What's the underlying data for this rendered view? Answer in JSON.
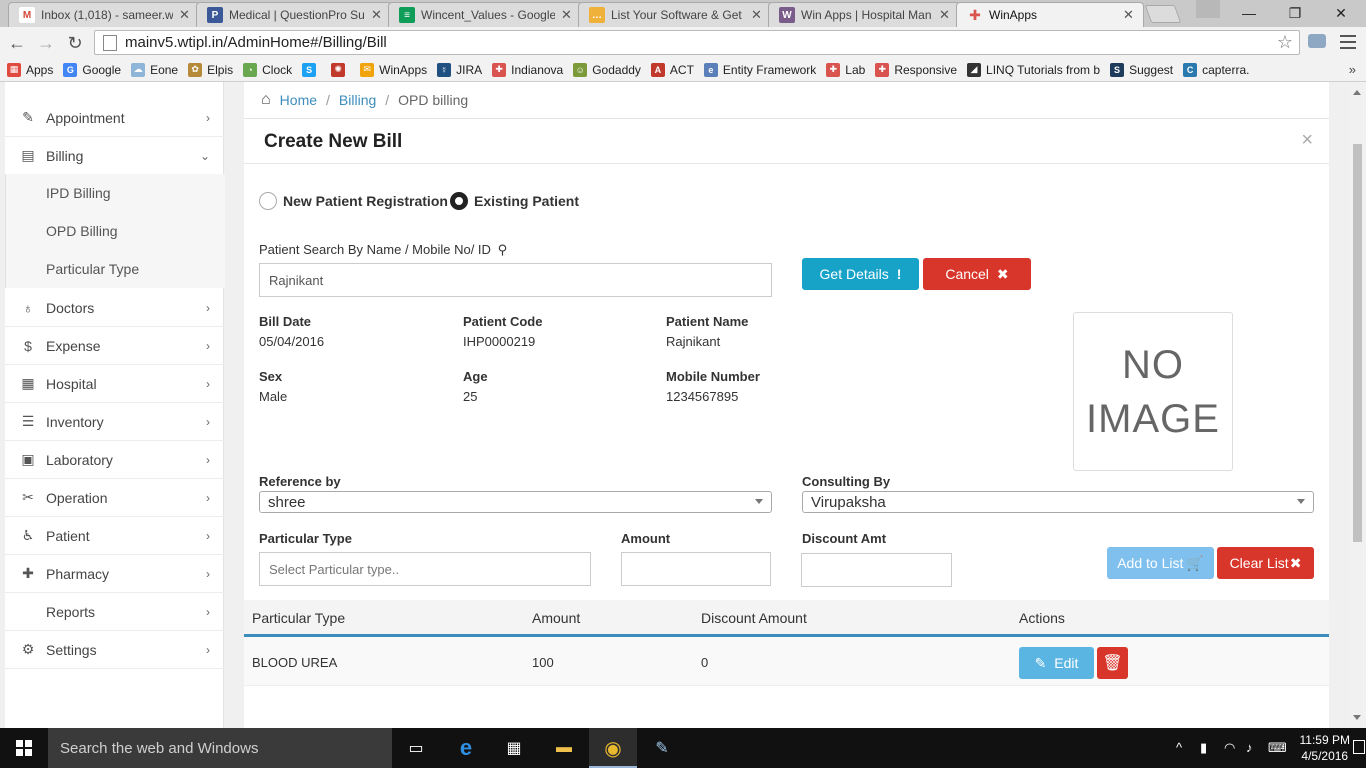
{
  "browser": {
    "tabs": [
      {
        "title": "Inbox (1,018) - sameer.wi",
        "icon": "gmail-icon",
        "color": "#d44638",
        "glyph": "M"
      },
      {
        "title": "Medical | QuestionPro Su",
        "icon": "questionpro-icon",
        "color": "#3b5998",
        "glyph": "P"
      },
      {
        "title": "Wincent_Values - Google",
        "icon": "google-sheets-icon",
        "color": "#0f9d58",
        "glyph": "≡"
      },
      {
        "title": "List Your Software & Get",
        "icon": "chat-bubble-icon",
        "color": "#f0b13a",
        "glyph": "…"
      },
      {
        "title": "Win Apps | Hospital Man",
        "icon": "winapps-w-icon",
        "color": "#7a5c8a",
        "glyph": "W"
      },
      {
        "title": "WinApps",
        "icon": "winapps-plus-icon",
        "color": "#d9534f",
        "glyph": "✚"
      }
    ],
    "url": "mainv5.wtipl.in/AdminHome#/Billing/Bill",
    "bookmarks": [
      {
        "label": "Apps",
        "color": "#e04a3f",
        "glyph": "▦"
      },
      {
        "label": "Google",
        "color": "#4285f4",
        "glyph": "G"
      },
      {
        "label": "Eone",
        "color": "#8fb6d9",
        "glyph": "☁"
      },
      {
        "label": "Elpis",
        "color": "#b58b3a",
        "glyph": "✿"
      },
      {
        "label": "Clock",
        "color": "#6aa84f",
        "glyph": "◔"
      },
      {
        "label": "",
        "color": "#1da1f2",
        "glyph": "S"
      },
      {
        "label": "",
        "color": "#c0392b",
        "glyph": "✺"
      },
      {
        "label": "WinApps",
        "color": "#f0a30a",
        "glyph": "✉"
      },
      {
        "label": "JIRA",
        "color": "#205081",
        "glyph": "☿"
      },
      {
        "label": "Indianova",
        "color": "#d9534f",
        "glyph": "✚"
      },
      {
        "label": "Godaddy",
        "color": "#7a9a3c",
        "glyph": "☺"
      },
      {
        "label": "ACT",
        "color": "#c0392b",
        "glyph": "A"
      },
      {
        "label": "Entity Framework",
        "color": "#5b7fb8",
        "glyph": "e"
      },
      {
        "label": "Lab",
        "color": "#d9534f",
        "glyph": "✚"
      },
      {
        "label": "Responsive",
        "color": "#d9534f",
        "glyph": "✚"
      },
      {
        "label": "LINQ Tutorials from b",
        "color": "#333333",
        "glyph": "◢"
      },
      {
        "label": "Suggest",
        "color": "#1f3b5c",
        "glyph": "S"
      },
      {
        "label": "capterra.",
        "color": "#2a7ab0",
        "glyph": "C"
      }
    ],
    "bookmarks_more": "»"
  },
  "sidebar": {
    "items": [
      {
        "label": "Appointment",
        "icon": "edit-icon",
        "glyph": "✎"
      },
      {
        "label": "Billing",
        "icon": "file-icon",
        "glyph": "▤"
      },
      {
        "label": "Doctors",
        "icon": "stethoscope-icon",
        "glyph": "♁"
      },
      {
        "label": "Expense",
        "icon": "dollar-icon",
        "glyph": "$"
      },
      {
        "label": "Hospital",
        "icon": "building-icon",
        "glyph": "▦"
      },
      {
        "label": "Inventory",
        "icon": "server-icon",
        "glyph": "☰"
      },
      {
        "label": "Laboratory",
        "icon": "briefcase-icon",
        "glyph": "▣"
      },
      {
        "label": "Operation",
        "icon": "scissors-icon",
        "glyph": "✂"
      },
      {
        "label": "Patient",
        "icon": "wheelchair-icon",
        "glyph": "♿"
      },
      {
        "label": "Pharmacy",
        "icon": "plus-icon",
        "glyph": "✚"
      },
      {
        "label": "Reports",
        "icon": "",
        "glyph": ""
      },
      {
        "label": "Settings",
        "icon": "gear-icon",
        "glyph": "⚙"
      }
    ],
    "billing_sub": [
      "IPD Billing",
      "OPD Billing",
      "Particular Type"
    ]
  },
  "breadcrumb": {
    "home": "Home",
    "billing": "Billing",
    "current": "OPD billing",
    "sep": "/"
  },
  "bill": {
    "title": "Create New Bill",
    "close": "×",
    "radio_new": "New Patient Registration",
    "radio_existing": "Existing Patient",
    "search_label": "Patient Search By Name / Mobile No/ ID",
    "search_value": "Rajnikant",
    "get_details": "Get Details",
    "cancel": "Cancel",
    "fields": {
      "bill_date_label": "Bill Date",
      "bill_date": "05/04/2016",
      "patient_code_label": "Patient Code",
      "patient_code": "IHP0000219",
      "patient_name_label": "Patient Name",
      "patient_name": "Rajnikant",
      "sex_label": "Sex",
      "sex": "Male",
      "age_label": "Age",
      "age": "25",
      "mobile_label": "Mobile Number",
      "mobile": "1234567895"
    },
    "no_image_line1": "NO",
    "no_image_line2": "IMAGE",
    "reference_label": "Reference by",
    "reference_value": "shree",
    "consulting_label": "Consulting By",
    "consulting_value": "Virupaksha",
    "particular_label": "Particular Type",
    "particular_placeholder": "Select Particular type..",
    "amount_label": "Amount",
    "discount_label": "Discount Amt",
    "add_to_list": "Add to List",
    "clear_list": "Clear List"
  },
  "table": {
    "headers": [
      "Particular Type",
      "Amount",
      "Discount Amount",
      "Actions"
    ],
    "rows": [
      {
        "particular": "BLOOD UREA",
        "amount": "100",
        "discount": "0",
        "edit": "Edit"
      }
    ]
  },
  "taskbar": {
    "search_placeholder": "Search the web and Windows",
    "time": "11:59 PM",
    "date": "4/5/2016"
  },
  "colors": {
    "primary": "#3c8dbc",
    "info": "#17a2c8",
    "danger": "#d9362b",
    "light_blue": "#80c0ef"
  }
}
